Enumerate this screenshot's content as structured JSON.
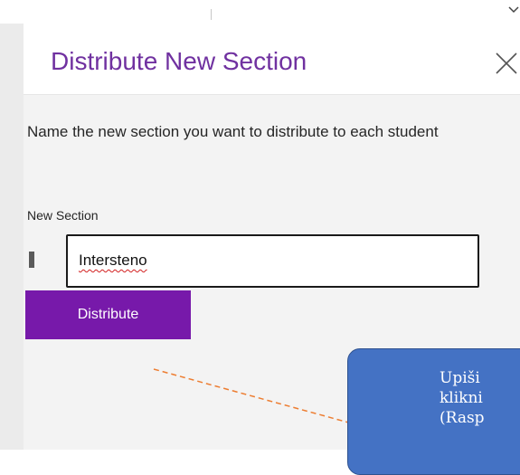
{
  "pane": {
    "title": "Distribute New Section",
    "instruction": "Name the new section you want to distribute to each student",
    "field_label": "New Section",
    "section_name_value": "Interstenо",
    "distribute_label": "Distribute"
  },
  "callout": {
    "text": "Upiši\nklikni\n(Rasp"
  },
  "colors": {
    "title": "#7031a0",
    "button": "#7719aa",
    "callout": "#4472c4",
    "connector": "#ed7d31"
  },
  "icons": {
    "close": "close-icon",
    "chevron": "chevron-down-icon"
  }
}
